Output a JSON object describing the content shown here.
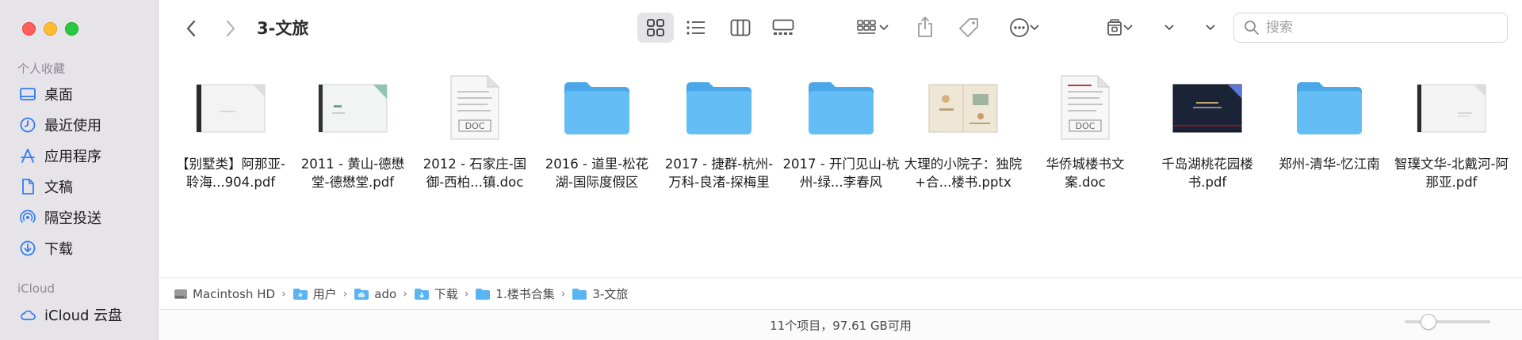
{
  "window": {
    "title": "3-文旅"
  },
  "sidebar": {
    "favorites_header": "个人收藏",
    "favorites": [
      {
        "label": "桌面",
        "icon": "desktop-icon"
      },
      {
        "label": "最近使用",
        "icon": "clock-icon"
      },
      {
        "label": "应用程序",
        "icon": "applications-icon"
      },
      {
        "label": "文稿",
        "icon": "document-icon"
      },
      {
        "label": "隔空投送",
        "icon": "airdrop-icon"
      },
      {
        "label": "下载",
        "icon": "download-icon"
      }
    ],
    "icloud_header": "iCloud",
    "icloud": [
      {
        "label": "iCloud 云盘",
        "icon": "icloud-icon"
      }
    ]
  },
  "search": {
    "placeholder": "搜索"
  },
  "files": [
    {
      "name": "【别墅类】阿那亚-聆海...904.pdf",
      "type": "pdf-white"
    },
    {
      "name": "2011 - 黄山-德懋堂-德懋堂.pdf",
      "type": "pdf-teal"
    },
    {
      "name": "2012 - 石家庄-国御-西柏...镇.doc",
      "type": "doc"
    },
    {
      "name": "2016 - 道里-松花湖-国际度假区",
      "type": "folder"
    },
    {
      "name": "2017 - 捷群-杭州-万科-良渚-探梅里",
      "type": "folder"
    },
    {
      "name": "2017 - 开门见山-杭州-绿...李春风",
      "type": "folder"
    },
    {
      "name": "大理的小院子：独院+合...楼书.pptx",
      "type": "pptx"
    },
    {
      "name": "华侨城楼书文案.doc",
      "type": "doc"
    },
    {
      "name": "千岛湖桃花园楼书.pdf",
      "type": "pdf-dark"
    },
    {
      "name": "郑州-清华-忆江南",
      "type": "folder"
    },
    {
      "name": "智璞文华-北戴河-阿那亚.pdf",
      "type": "pdf-white"
    }
  ],
  "pathbar": [
    "Macintosh HD",
    "用户",
    "ado",
    "下载",
    "1.楼书合集",
    "3-文旅"
  ],
  "status": {
    "text": "11个项目，97.61 GB可用"
  },
  "colors": {
    "folder": "#5cb8f5",
    "sidebar_icon": "#2f7cf6",
    "sidebar_bg": "#e6e3e9"
  }
}
